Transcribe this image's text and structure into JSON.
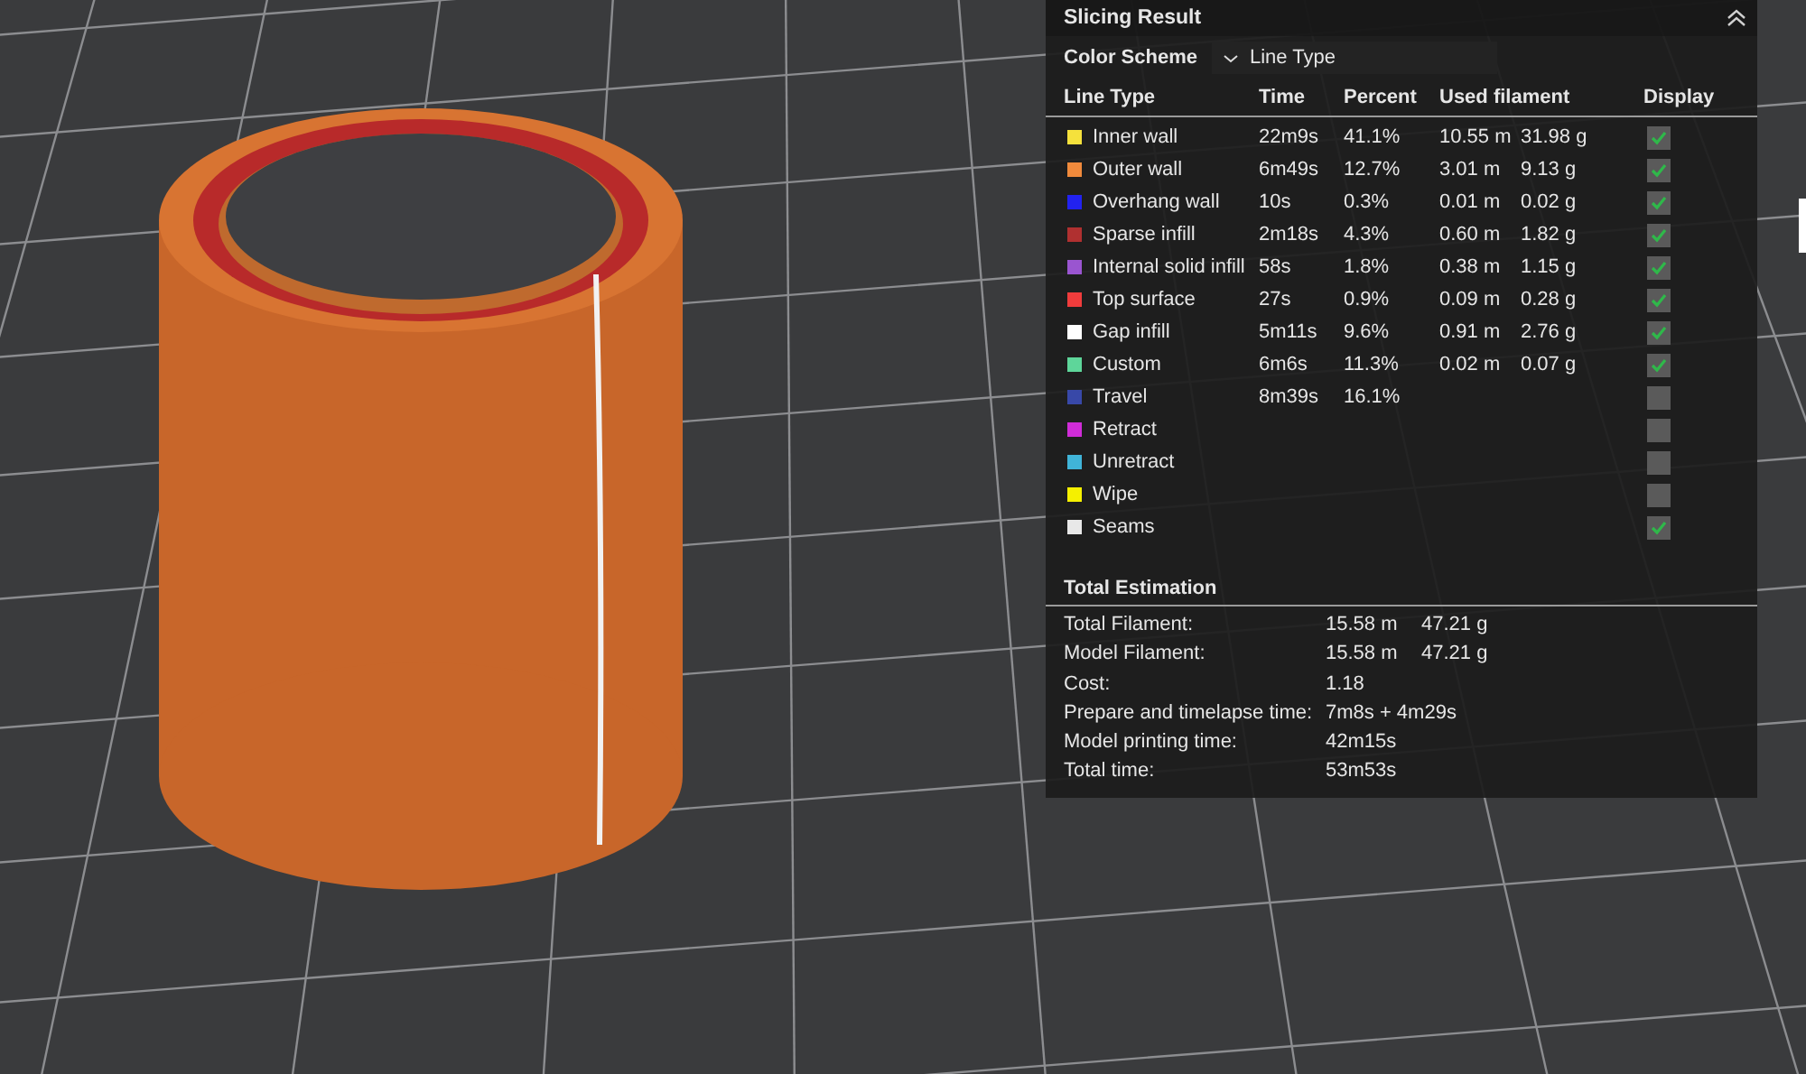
{
  "panel": {
    "title": "Slicing Result",
    "color_scheme": {
      "label": "Color Scheme",
      "value": "Line Type"
    },
    "columns": [
      "Line Type",
      "Time",
      "Percent",
      "Used filament",
      "Display"
    ],
    "line_types": [
      {
        "name": "Inner wall",
        "color": "#f5e13c",
        "time": "22m9s",
        "percent": "41.1%",
        "length": "10.55 m",
        "weight": "31.98 g",
        "checked": true
      },
      {
        "name": "Outer wall",
        "color": "#f08a3c",
        "time": "6m49s",
        "percent": "12.7%",
        "length": "3.01 m",
        "weight": "9.13 g",
        "checked": true
      },
      {
        "name": "Overhang wall",
        "color": "#2222f0",
        "time": "10s",
        "percent": "0.3%",
        "length": "0.01 m",
        "weight": "0.02 g",
        "checked": true
      },
      {
        "name": "Sparse infill",
        "color": "#b03030",
        "time": "2m18s",
        "percent": "4.3%",
        "length": "0.60 m",
        "weight": "1.82 g",
        "checked": true
      },
      {
        "name": "Internal solid infill",
        "color": "#9a55d0",
        "time": "58s",
        "percent": "1.8%",
        "length": "0.38 m",
        "weight": "1.15 g",
        "checked": true
      },
      {
        "name": "Top surface",
        "color": "#f03c3c",
        "time": "27s",
        "percent": "0.9%",
        "length": "0.09 m",
        "weight": "0.28 g",
        "checked": true
      },
      {
        "name": "Gap infill",
        "color": "#ffffff",
        "time": "5m11s",
        "percent": "9.6%",
        "length": "0.91 m",
        "weight": "2.76 g",
        "checked": true
      },
      {
        "name": "Custom",
        "color": "#5ed69a",
        "time": "6m6s",
        "percent": "11.3%",
        "length": "0.02 m",
        "weight": "0.07 g",
        "checked": true
      },
      {
        "name": "Travel",
        "color": "#3848a8",
        "time": "8m39s",
        "percent": "16.1%",
        "checked": false
      },
      {
        "name": "Retract",
        "color": "#d02cd8",
        "checked": false
      },
      {
        "name": "Unretract",
        "color": "#40b4d8",
        "checked": false
      },
      {
        "name": "Wipe",
        "color": "#f5f000",
        "checked": false
      },
      {
        "name": "Seams",
        "color": "#e8e8e8",
        "checked": true
      }
    ],
    "total": {
      "title": "Total Estimation",
      "rows": [
        {
          "label": "Total Filament:",
          "value": "15.58 m",
          "value_2": "47.21 g"
        },
        {
          "label": "Model Filament:",
          "value": "15.58 m",
          "value_2": "47.21 g"
        },
        {
          "label": "Cost:",
          "value": "1.18"
        },
        {
          "label": "Prepare and timelapse time:",
          "value": "7m8s + 4m29s"
        },
        {
          "label": "Model printing time:",
          "value": "42m15s"
        },
        {
          "label": "Total time:",
          "value": "53m53s"
        }
      ]
    }
  }
}
